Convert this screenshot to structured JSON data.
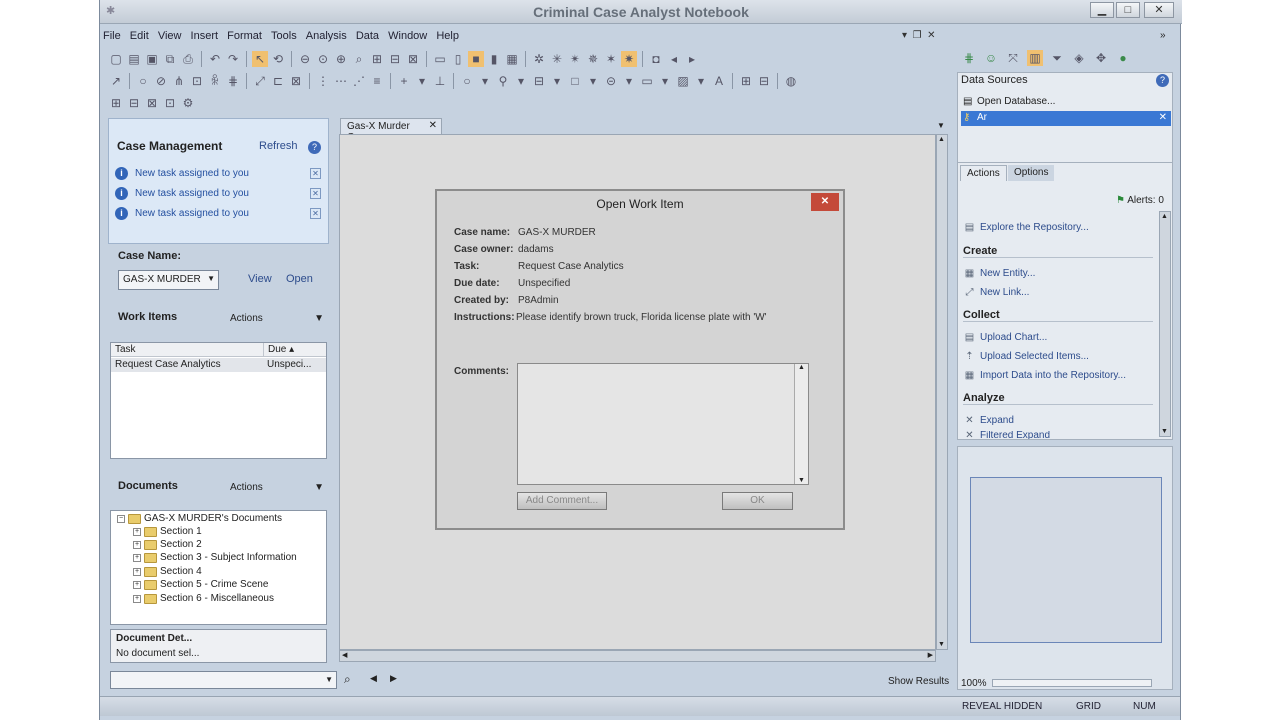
{
  "window": {
    "title": "Criminal Case Analyst Notebook"
  },
  "menu": [
    "File",
    "Edit",
    "View",
    "Insert",
    "Format",
    "Tools",
    "Analysis",
    "Data",
    "Window",
    "Help"
  ],
  "case_management": {
    "title": "Case Management",
    "refresh": "Refresh",
    "notifications": [
      "New task assigned to you",
      "New task assigned to you",
      "New task assigned to you"
    ],
    "case_name_label": "Case Name:",
    "case_name_value": "GAS-X MURDER",
    "view": "View",
    "open": "Open"
  },
  "work_items": {
    "label": "Work Items",
    "actions": "Actions",
    "columns": [
      "Task",
      "Due"
    ],
    "rows": [
      {
        "task": "Request Case Analytics",
        "due": "Unspeci..."
      }
    ]
  },
  "documents": {
    "label": "Documents",
    "actions": "Actions",
    "root": "GAS-X MURDER's Documents",
    "sections": [
      "Section 1",
      "Section 2",
      "Section 3 - Subject Information",
      "Section 4",
      "Section 5 - Crime Scene",
      "Section 6 - Miscellaneous"
    ]
  },
  "document_details": {
    "title": "Document Det...",
    "value": "No document sel..."
  },
  "editor": {
    "tab": "Gas-X Murder Case"
  },
  "dialog": {
    "title": "Open Work Item",
    "fields": [
      {
        "k": "Case name:",
        "v": "GAS-X MURDER"
      },
      {
        "k": "Case owner:",
        "v": "dadams"
      },
      {
        "k": "Task:",
        "v": "Request Case Analytics"
      },
      {
        "k": "Due date:",
        "v": "Unspecified"
      },
      {
        "k": "Created by:",
        "v": "P8Admin"
      },
      {
        "k": "Instructions:",
        "v": "Please identify brown truck, Florida license plate with 'W'"
      }
    ],
    "comments_label": "Comments:",
    "add_comment": "Add Comment...",
    "ok": "OK"
  },
  "data_sources": {
    "title": "Data Sources",
    "items": [
      "Open Database...",
      "Ar"
    ]
  },
  "actions_panel": {
    "tabs": [
      "Actions",
      "Options"
    ],
    "alerts": "Alerts: 0",
    "explore": "Explore the Repository...",
    "sections": [
      {
        "title": "Create",
        "items": [
          "New Entity...",
          "New Link..."
        ]
      },
      {
        "title": "Collect",
        "items": [
          "Upload Chart...",
          "Upload Selected Items...",
          "Import Data into the Repository..."
        ]
      },
      {
        "title": "Analyze",
        "items": [
          "Expand",
          "Filtered Expand"
        ]
      }
    ]
  },
  "overview": {
    "zoom": "100%"
  },
  "bottom": {
    "show_results": "Show Results"
  },
  "status": {
    "reveal": "REVEAL HIDDEN",
    "grid": "GRID",
    "num": "NUM"
  }
}
